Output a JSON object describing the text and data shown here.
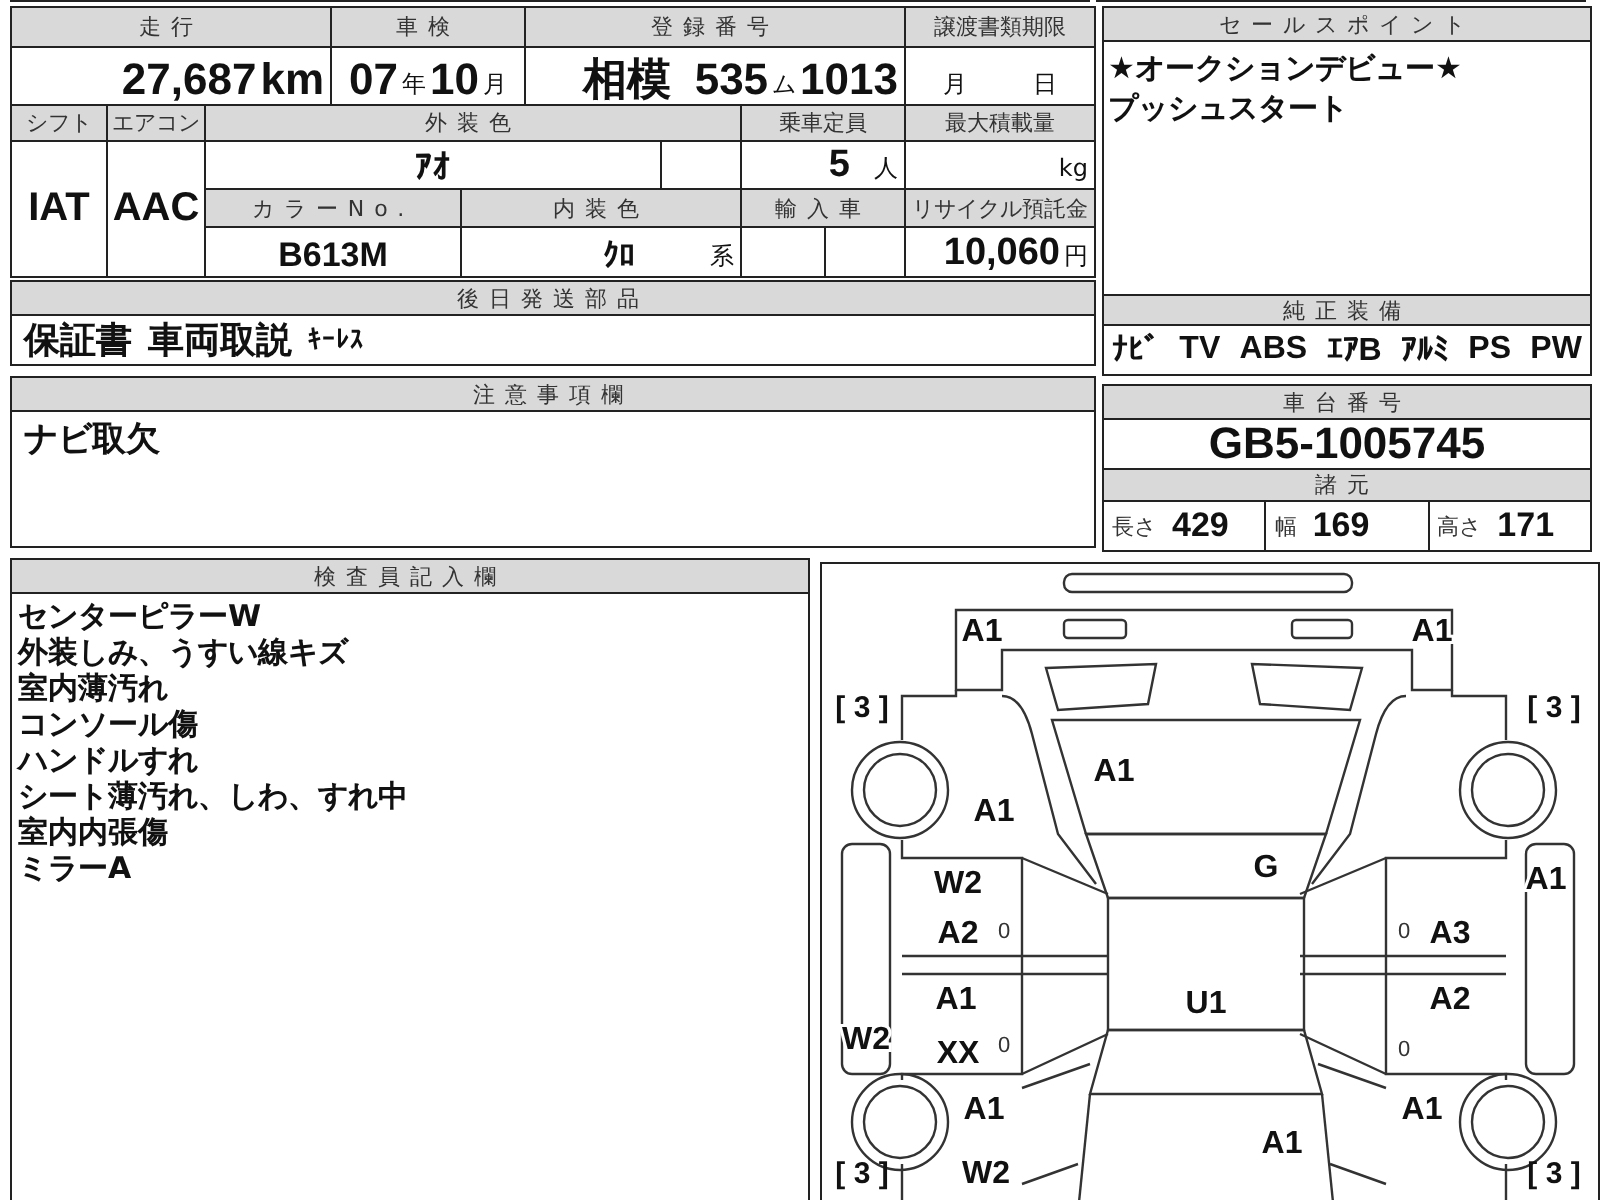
{
  "mileage": {
    "label": "走行",
    "value": "27,687",
    "unit": "km"
  },
  "inspection": {
    "label": "車検",
    "year": "07",
    "year_unit": "年",
    "month": "10",
    "month_unit": "月"
  },
  "registration": {
    "label": "登録番号",
    "region": "相模",
    "plate_class": "535",
    "plate_kana": "ム",
    "plate_number": "1013"
  },
  "transfer_deadline": {
    "label": "譲渡書類期限",
    "month_unit": "月",
    "day_unit": "日"
  },
  "shift": {
    "label": "シフト",
    "value": "IAT"
  },
  "aircon": {
    "label": "エアコン",
    "value": "AAC"
  },
  "exterior_color": {
    "label": "外装色",
    "value": "ｱｵ"
  },
  "capacity": {
    "label": "乗車定員",
    "value": "5",
    "unit": "人"
  },
  "max_load": {
    "label": "最大積載量",
    "unit": "kg"
  },
  "color_no": {
    "label": "カラーNo.",
    "value": "B613M"
  },
  "interior_color": {
    "label": "内装色",
    "value": "ｸﾛ",
    "suffix": "系"
  },
  "import": {
    "label": "輸入車"
  },
  "recycle": {
    "label": "リサイクル預託金",
    "value": "10,060",
    "unit": "円"
  },
  "later_parts": {
    "label": "後日発送部品",
    "items": [
      {
        "text": "保証書",
        "kind": "full"
      },
      {
        "text": "車両取説",
        "kind": "full"
      },
      {
        "text": "ｷｰﾚｽ",
        "kind": "half"
      }
    ]
  },
  "notes": {
    "label": "注意事項欄",
    "lines": [
      "ナビ取欠"
    ]
  },
  "sales_points": {
    "label": "セールスポイント",
    "lines": [
      "★オークションデビュー★",
      "プッシュスタート"
    ]
  },
  "equipment": {
    "label": "純正装備",
    "items": [
      "ﾅﾋﾞ",
      "TV",
      "ABS",
      "ｴｱB",
      "ｱﾙﾐ",
      "PS",
      "PW"
    ]
  },
  "chassis": {
    "label": "車台番号",
    "value": "GB5-1005745"
  },
  "specs": {
    "label": "諸元",
    "items": [
      {
        "label": "長さ",
        "value": "429"
      },
      {
        "label": "幅",
        "value": "169"
      },
      {
        "label": "高さ",
        "value": "171"
      }
    ]
  },
  "inspector": {
    "label": "検査員記入欄",
    "lines": [
      "センターピラーW",
      "外装しみ、うすい線キズ",
      "室内薄汚れ",
      "コンソール傷",
      "ハンドルすれ",
      "シート薄汚れ、しわ、すれ中",
      "室内内張傷",
      "ミラーA"
    ]
  },
  "diagram": {
    "damage_codes": [
      "A1",
      "A1",
      "A1",
      "A1",
      "W2",
      "G",
      "A1",
      "A2",
      "A3",
      "A1",
      "U1",
      "A2",
      "W2",
      "XX",
      "A1",
      "A1",
      "A1",
      "W2"
    ],
    "door_marks": [
      "0",
      "0",
      "0",
      "0"
    ],
    "tread_depths": [
      "[ 3 ]",
      "[ 3 ]",
      "[ 3 ]",
      "[ 3 ]"
    ]
  }
}
